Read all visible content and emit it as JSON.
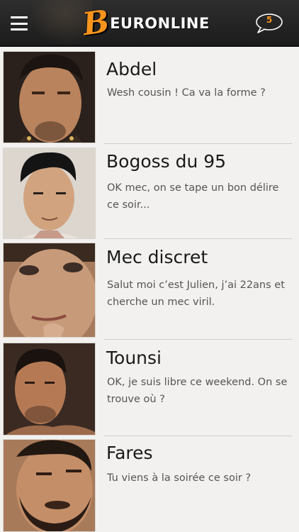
{
  "header": {
    "logo_initial": "B",
    "logo_rest": "EURONLINE",
    "unread_count": "5",
    "colors": {
      "bar": "#222222",
      "accent": "#f7941d"
    }
  },
  "conversations": [
    {
      "name": "Abdel",
      "message": "Wesh cousin ! Ca va la forme ?"
    },
    {
      "name": "Bogoss du 95",
      "message": "OK mec, on se tape un bon délire ce soir..."
    },
    {
      "name": "Mec discret",
      "message": "Salut moi c’est Julien, j’ai 22ans et cherche un mec viril."
    },
    {
      "name": "Tounsi",
      "message": "OK, je suis libre ce weekend. On se trouve où ?"
    },
    {
      "name": "Fares",
      "message": "Tu viens à la soirée ce soir ?"
    }
  ]
}
